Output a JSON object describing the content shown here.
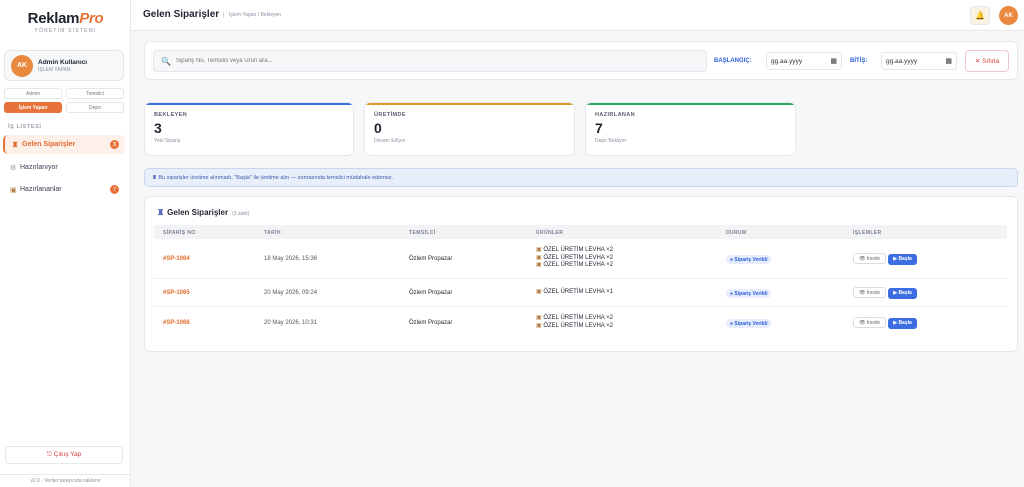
{
  "app": {
    "logo_main": "Reklam",
    "logo_accent": "Pro",
    "logo_sub": "YÖNETİM SİSTEMİ"
  },
  "user": {
    "initials": "AK",
    "name": "Admin Kullanıcı",
    "role": "İŞLEM YAPAN"
  },
  "roles": [
    "Admin",
    "Temsilci",
    "İşlem Yapan",
    "Depo"
  ],
  "active_role": "İşlem Yapan",
  "section_label": "İŞ LİSTESİ",
  "nav": [
    {
      "label": "Gelen Siparişler",
      "icon": "♜",
      "count": "3",
      "active": true
    },
    {
      "label": "Hazırlanıyor",
      "icon": "⚙",
      "count": "",
      "active": false
    },
    {
      "label": "Hazırlananlar",
      "icon": "▣",
      "count": "7",
      "active": false
    }
  ],
  "logout_label": "⎋ Çıkış Yap",
  "footer": "v2.0 · Veriler tarayıcıda saklanır",
  "header": {
    "title": "Gelen Siparişler",
    "breadcrumb": "İşlem Yapan / Bekleyen",
    "avatar": "AK",
    "bell": "🔔"
  },
  "filter": {
    "search_placeholder": "Sipariş No, Temsilci veya Ürün ara...",
    "start_label": "BAŞLANGIÇ:",
    "end_label": "BİTİŞ:",
    "start_value": "gg.aa.yyyy",
    "end_value": "gg.aa.yyyy",
    "reset_label": "✕ Sıfırla"
  },
  "stats": [
    {
      "title": "BEKLEYEN",
      "value": "3",
      "sub": "Yeni Sipariş",
      "color": "#3b6de0"
    },
    {
      "title": "ÜRETİMDE",
      "value": "0",
      "sub": "Devam Ediyor",
      "color": "#d99a26"
    },
    {
      "title": "HAZIRLANAN",
      "value": "7",
      "sub": "Depo Bekliyor",
      "color": "#2fa860"
    }
  ],
  "info": "♜ Bu siparişler üretime alınmadı. \"Başla\" ile üretime alın — sonrasında temsilci müdahale edemez.",
  "panel": {
    "title": "Gelen Siparişler",
    "count": "(3 adet)"
  },
  "columns": [
    "SİPARİŞ NO",
    "TARİH",
    "TEMSİLCİ",
    "ÜRÜNLER",
    "DURUM",
    "İŞLEMLER"
  ],
  "orders": [
    {
      "id": "#SP-1064",
      "date": "18 May 2026, 15:36",
      "rep": "Özlem Propazar",
      "products": [
        "ÖZEL ÜRETİM LEVHA ×2",
        "ÖZEL ÜRETİM LEVHA ×2",
        "ÖZEL ÜRETİM LEVHA ×2"
      ],
      "status": "● Sipariş Verildi"
    },
    {
      "id": "#SP-1065",
      "date": "20 May 2026, 09:24",
      "rep": "Özlem Propazar",
      "products": [
        "ÖZEL ÜRETİM LEVHA ×1"
      ],
      "status": "● Sipariş Verildi"
    },
    {
      "id": "#SP-1066",
      "date": "20 May 2026, 10:31",
      "rep": "Özlem Propazar",
      "products": [
        "ÖZEL ÜRETİM LEVHA ×2",
        "ÖZEL ÜRETİM LEVHA ×2"
      ],
      "status": "● Sipariş Verildi"
    }
  ],
  "actions": {
    "inspect": "👁 İncele",
    "start": "▶ Başla"
  }
}
